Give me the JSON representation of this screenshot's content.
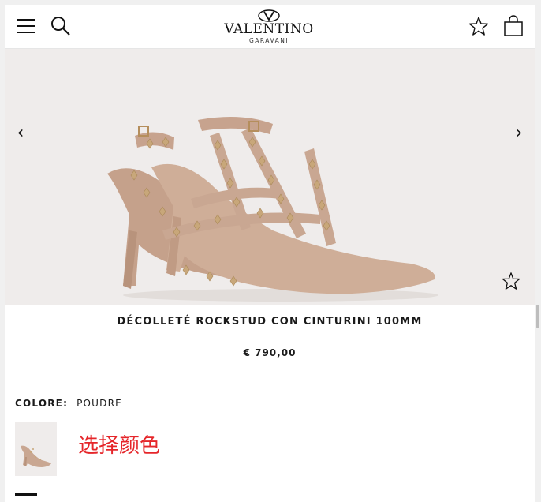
{
  "header": {
    "menu_icon": "hamburger-menu-icon",
    "search_icon": "search-icon",
    "logo_word": "VALENTINO",
    "logo_sub": "GARAVANI",
    "wishlist_icon": "star-icon",
    "bag_icon": "shopping-bag-icon"
  },
  "gallery": {
    "prev_label": "‹",
    "next_label": "›",
    "wishlist_icon": "star-icon"
  },
  "product": {
    "title": "DÉCOLLETÉ ROCKSTUD CON CINTURINI 100MM",
    "price": "€ 790,00"
  },
  "color": {
    "label": "COLORE:",
    "value": "POUDRE"
  },
  "annotation": "选择颜色",
  "colors": {
    "hero_bg": "#efeceb",
    "shoe_leather": "#c9a892",
    "stud_gold": "#c8a77a",
    "annotation_red": "#e5262a"
  }
}
